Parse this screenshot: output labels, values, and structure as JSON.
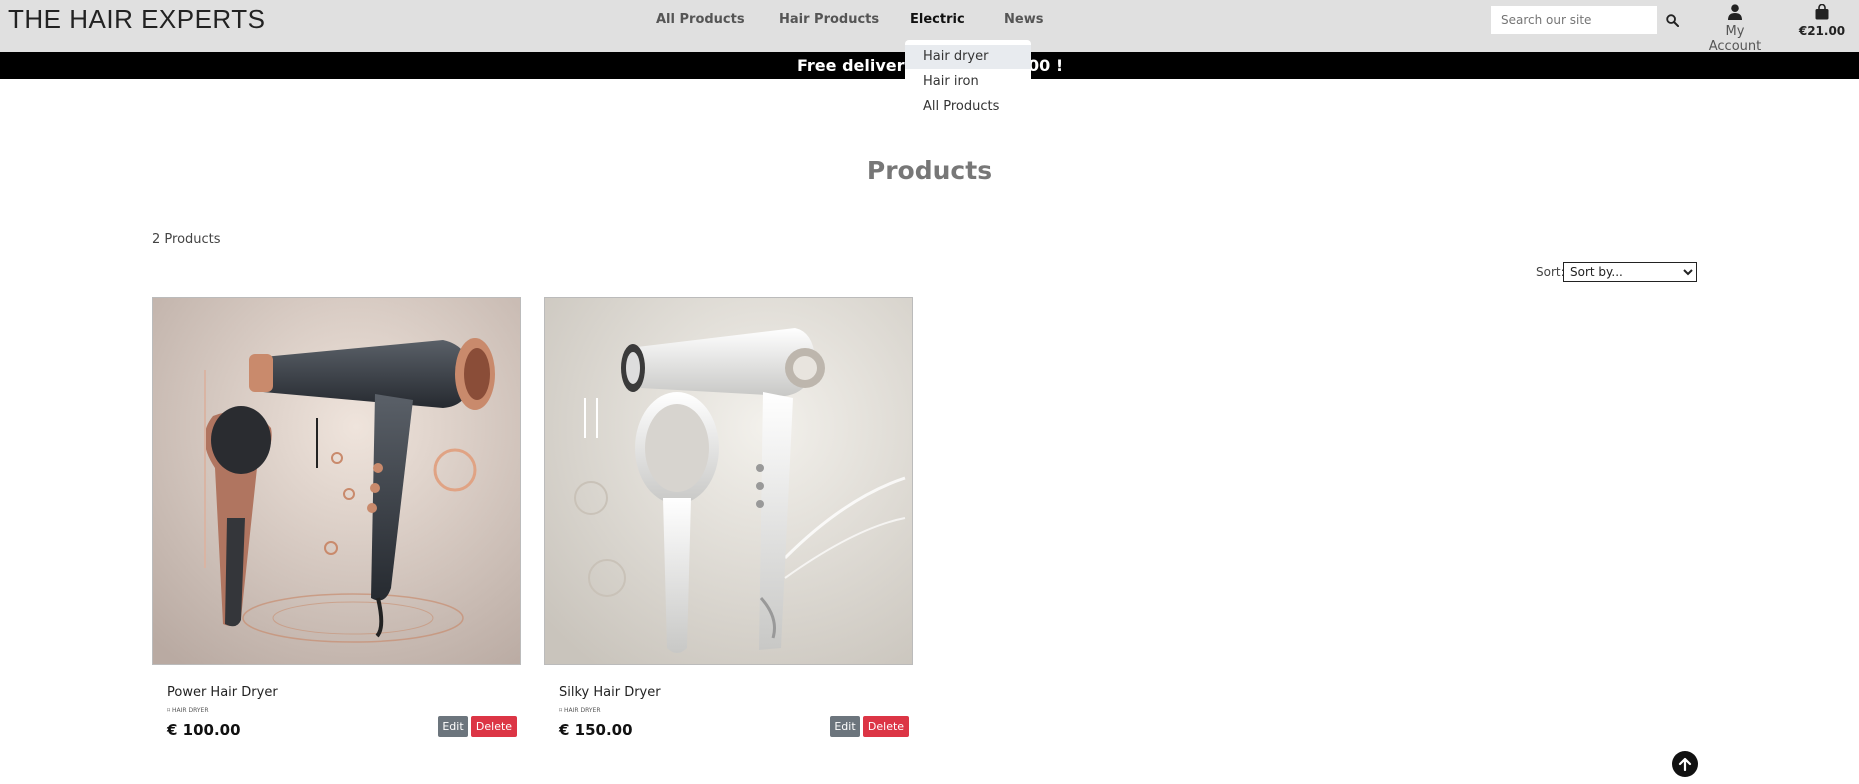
{
  "header": {
    "brand": "THE HAIR EXPERTS",
    "nav": [
      "All Products",
      "Hair Products",
      "Electric",
      "News"
    ],
    "search_placeholder": "Search our site",
    "account_label": "My Account",
    "cart_total": "€21.00"
  },
  "banner": {
    "text": "Free delivery o",
    "text_end": "00 !"
  },
  "dropdown": {
    "items": [
      "Hair dryer",
      "Hair iron",
      "All Products"
    ]
  },
  "main": {
    "title": "Products",
    "count": "2 Products",
    "sort_label": "Sort:",
    "sort_selected": "Sort by..."
  },
  "products": [
    {
      "name": "Power Hair Dryer",
      "category": "HAIR DRYER",
      "price": "€ 100.00",
      "edit": "Edit",
      "delete": "Delete"
    },
    {
      "name": "Silky Hair Dryer",
      "category": "HAIR DRYER",
      "price": "€ 150.00",
      "edit": "Edit",
      "delete": "Delete"
    }
  ],
  "colors": {
    "danger": "#dc3545",
    "secondary": "#6c757d",
    "banner": "#000000",
    "header": "#e0e0e0"
  },
  "icons": [
    "search-icon",
    "user-icon",
    "shopping-bag-icon",
    "arrow-up-icon"
  ]
}
